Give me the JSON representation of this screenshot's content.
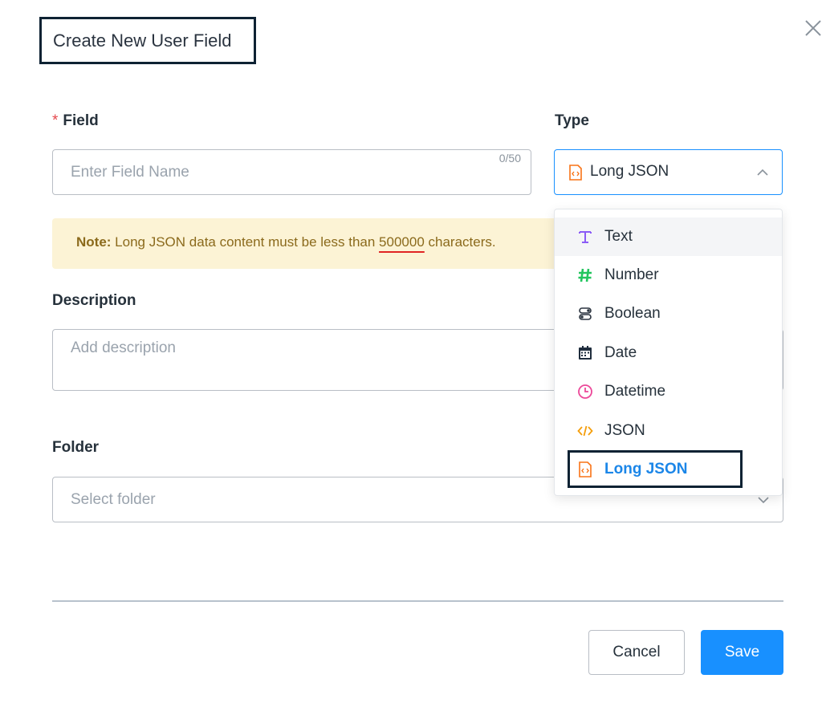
{
  "dialog": {
    "title": "Create New User Field"
  },
  "field": {
    "label": "Field",
    "required_mark": "*",
    "placeholder": "Enter Field Name",
    "counter": "0/50"
  },
  "type": {
    "label": "Type",
    "value": "Long JSON",
    "options": [
      {
        "label": "Text",
        "icon": "text-icon"
      },
      {
        "label": "Number",
        "icon": "hash-icon"
      },
      {
        "label": "Boolean",
        "icon": "toggle-icon"
      },
      {
        "label": "Date",
        "icon": "calendar-icon"
      },
      {
        "label": "Datetime",
        "icon": "clock-icon"
      },
      {
        "label": "JSON",
        "icon": "code-icon"
      },
      {
        "label": "Long JSON",
        "icon": "code-file-icon"
      }
    ]
  },
  "note": {
    "prefix": "Note:",
    "text_before": " Long JSON data content must be less than ",
    "limit": "500000",
    "text_after": " characters."
  },
  "description": {
    "label": "Description",
    "placeholder": "Add description"
  },
  "folder": {
    "label": "Folder",
    "placeholder": "Select folder"
  },
  "footer": {
    "cancel_label": "Cancel",
    "save_label": "Save"
  },
  "colors": {
    "primary": "#1890ff",
    "note_bg": "#fcf3d5",
    "note_text": "#8b6a1c",
    "text_icon": "#8b5cf6",
    "number_icon": "#22c55e",
    "datetime_icon": "#ec4899",
    "json_icon": "#f59e0b",
    "long_json_icon": "#f97316"
  }
}
